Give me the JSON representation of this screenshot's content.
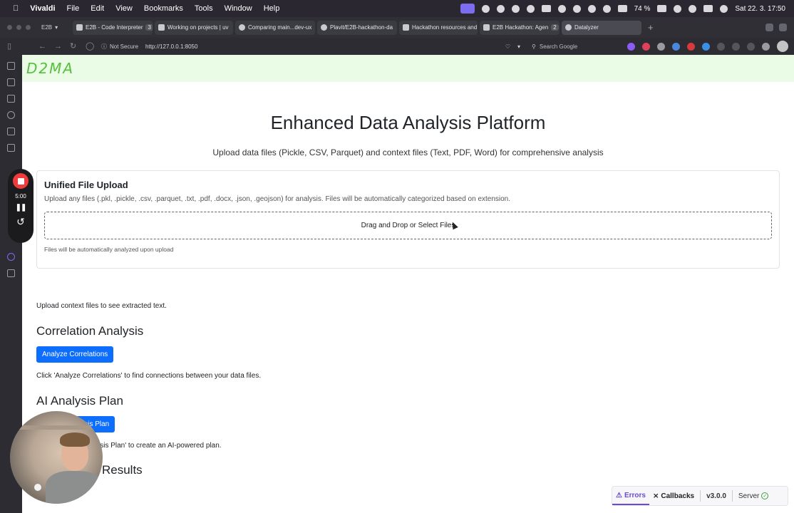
{
  "menubar": {
    "app": "Vivaldi",
    "items": [
      "File",
      "Edit",
      "View",
      "Bookmarks",
      "Tools",
      "Window",
      "Help"
    ],
    "battery": "74 %",
    "clock": "Sat 22. 3.  17:50"
  },
  "tabbar": {
    "workspace": "E2B",
    "tabs": [
      {
        "label": "E2B - Code Interpreter",
        "count": "3"
      },
      {
        "label": "Working on projects | uv",
        "count": ""
      },
      {
        "label": "Comparing main...dev-ux",
        "count": ""
      },
      {
        "label": "Plavit/E2B-hackathon-da",
        "count": ""
      },
      {
        "label": "Hackathon resources and",
        "count": ""
      },
      {
        "label": "E2B Hackathon: Agen",
        "count": "2"
      },
      {
        "label": "Datalyzer",
        "count": ""
      }
    ]
  },
  "addressbar": {
    "security": "Not Secure",
    "url": "http://127.0.0.1:8050",
    "search_placeholder": "Search Google"
  },
  "recorder": {
    "time": "5:00"
  },
  "page": {
    "logo": "D2MA",
    "title": "Enhanced Data Analysis Platform",
    "subtitle": "Upload data files (Pickle, CSV, Parquet) and context files (Text, PDF, Word) for comprehensive analysis",
    "upload": {
      "title": "Unified File Upload",
      "description": "Upload any files (.pkl, .pickle, .csv, .parquet, .txt, .pdf, .docx, .json, .geojson) for analysis. Files will be automatically categorized based on extension.",
      "dropzone": "Drag and Drop or Select Files",
      "note": "Files will be automatically analyzed upon upload"
    },
    "context_text": "Upload context files to see extracted text.",
    "correlation": {
      "heading": "Correlation Analysis",
      "button": "Analyze Correlations",
      "hint": "Click 'Analyze Correlations' to find connections between your data files."
    },
    "ai_plan": {
      "heading": "AI Analysis Plan",
      "button": "lysis Plan",
      "hint": "lysis Plan' to create an AI-powered plan."
    },
    "results": {
      "heading": "Results"
    }
  },
  "devtools": {
    "errors": "Errors",
    "callbacks": "Callbacks",
    "version": "v3.0.0",
    "server": "Server"
  }
}
